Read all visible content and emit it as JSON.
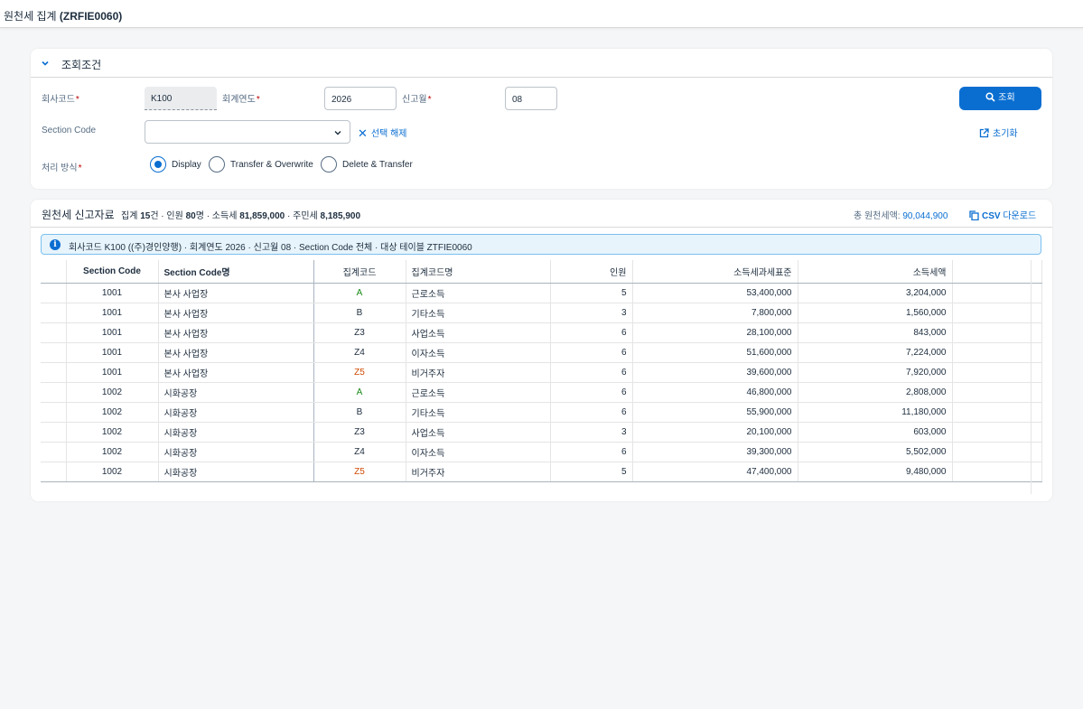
{
  "app": {
    "title_prefix": "원천세 집계",
    "title_code": "(ZRFIE0060)"
  },
  "filter": {
    "title": "조회조건",
    "company_code_label": "회사코드",
    "company_code_value": "K100",
    "fiscal_year_label": "회계연도",
    "fiscal_year_value": "2026",
    "report_month_label": "신고월",
    "report_month_value": "08",
    "section_code_label": "Section Code",
    "section_code_value": "",
    "clear_selection": "선택 해제",
    "search_button": "조회",
    "reset_button": "초기화",
    "process_mode_label": "처리 방식",
    "required_mark": "*",
    "modes": [
      {
        "label": "Display",
        "checked": true
      },
      {
        "label": "Transfer & Overwrite",
        "checked": false
      },
      {
        "label": "Delete & Transfer",
        "checked": false
      }
    ]
  },
  "result": {
    "title": "원천세 신고자료",
    "summary": {
      "agg_label": "집계",
      "agg_count": "15",
      "agg_unit": "건 · 인원",
      "person_count": "80",
      "person_unit": "명 · 소득세",
      "income_tax": "81,859,000",
      "resident_label": " · 주민세",
      "resident_tax": "8,185,900"
    },
    "total_label": "총 원천세액:",
    "total_value": "90,044,900",
    "csv_label": "CSV",
    "csv_suffix": "다운로드",
    "info_text": "회사코드 K100 ((주)경인양행) · 회계연도 2026 · 신고월 08 · Section Code 전체 · 대상 테이블 ZTFIE0060"
  },
  "table": {
    "headers": [
      "Section Code",
      "Section Code명",
      "집계코드",
      "집계코드명",
      "인원",
      "소득세과세표준",
      "소득세액"
    ],
    "rows": [
      [
        "1001",
        "본사 사업장",
        "A",
        "근로소득",
        "5",
        "53,400,000",
        "3,204,000"
      ],
      [
        "1001",
        "본사 사업장",
        "B",
        "기타소득",
        "3",
        "7,800,000",
        "1,560,000"
      ],
      [
        "1001",
        "본사 사업장",
        "Z3",
        "사업소득",
        "6",
        "28,100,000",
        "843,000"
      ],
      [
        "1001",
        "본사 사업장",
        "Z4",
        "이자소득",
        "6",
        "51,600,000",
        "7,224,000"
      ],
      [
        "1001",
        "본사 사업장",
        "Z5",
        "비거주자",
        "6",
        "39,600,000",
        "7,920,000"
      ],
      [
        "1002",
        "시화공장",
        "A",
        "근로소득",
        "6",
        "46,800,000",
        "2,808,000"
      ],
      [
        "1002",
        "시화공장",
        "B",
        "기타소득",
        "6",
        "55,900,000",
        "11,180,000"
      ],
      [
        "1002",
        "시화공장",
        "Z3",
        "사업소득",
        "3",
        "20,100,000",
        "603,000"
      ],
      [
        "1002",
        "시화공장",
        "Z4",
        "이자소득",
        "6",
        "39,300,000",
        "5,502,000"
      ],
      [
        "1002",
        "시화공장",
        "Z5",
        "비거주자",
        "5",
        "47,400,000",
        "9,480,000"
      ]
    ]
  },
  "colors": {
    "accent": "#0a6ed1",
    "required": "#bb0000",
    "code_a": "#188918",
    "code_z5": "#d04a02",
    "info_bg": "#e7f4fc"
  }
}
